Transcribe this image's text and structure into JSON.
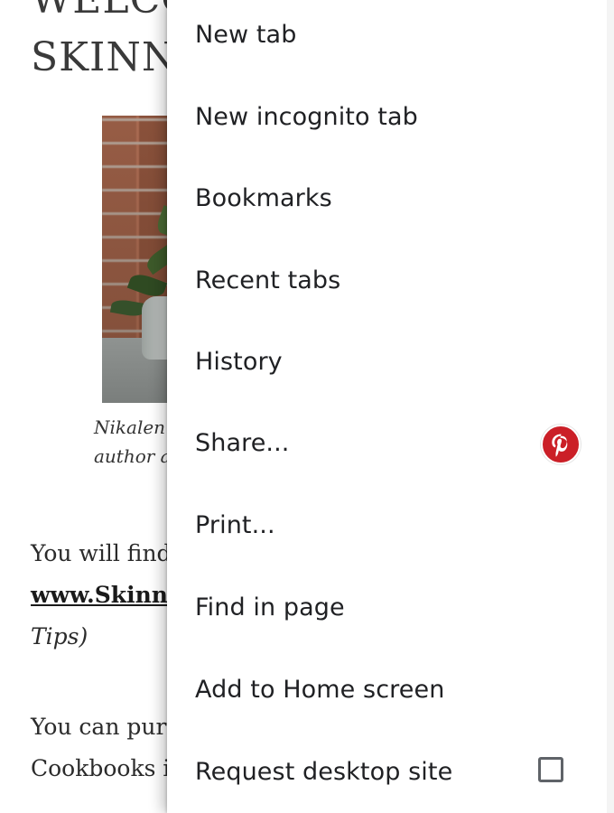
{
  "page": {
    "heading_line_1": "WELCO",
    "heading_line_2": "SKINN",
    "caption_line_1": "Nikalen",
    "caption_line_2": "author a",
    "paragraph_1_line_1": "You will find",
    "paragraph_1_link": "www.Skinn",
    "paragraph_1_line_3": "Tips)",
    "paragraph_2_line_1": "You can pur",
    "paragraph_2_line_2": "Cookbooks i"
  },
  "menu": {
    "items": [
      {
        "label": "New tab"
      },
      {
        "label": "New incognito tab"
      },
      {
        "label": "Bookmarks"
      },
      {
        "label": "Recent tabs"
      },
      {
        "label": "History"
      },
      {
        "label": "Share..."
      },
      {
        "label": "Print..."
      },
      {
        "label": "Find in page"
      },
      {
        "label": "Add to Home screen"
      },
      {
        "label": "Request desktop site"
      }
    ],
    "share_icon": "pinterest-icon",
    "request_desktop_checked": false
  },
  "colors": {
    "menu_background": "#ffffff",
    "menu_text": "#202124",
    "pinterest_red": "#cb1f27"
  }
}
